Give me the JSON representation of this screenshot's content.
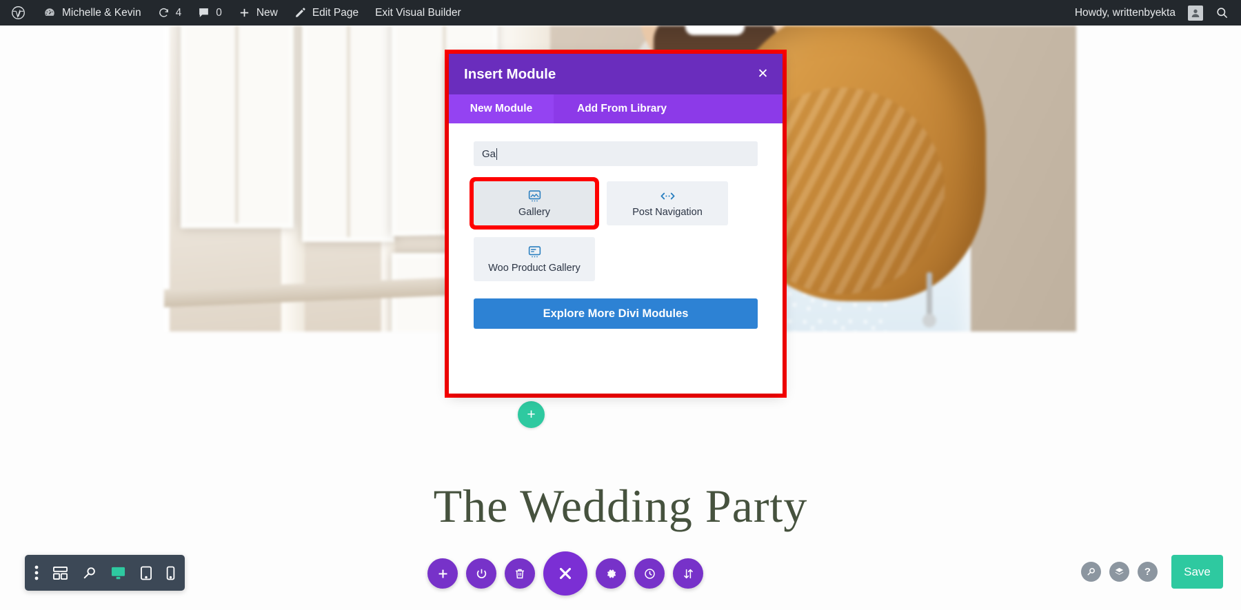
{
  "admin_bar": {
    "wp_logo_icon": "wordpress-logo-icon",
    "site": {
      "icon": "dashboard-icon",
      "label": "Michelle & Kevin"
    },
    "updates": {
      "icon": "updates-icon",
      "count": "4"
    },
    "comments": {
      "icon": "comment-bubble-icon",
      "count": "0"
    },
    "new": {
      "icon": "plus-icon",
      "label": "New"
    },
    "edit_page": {
      "icon": "pencil-icon",
      "label": "Edit Page"
    },
    "exit_builder": {
      "label": "Exit Visual Builder"
    },
    "howdy": "Howdy, writtenbyekta",
    "avatar_icon": "user-avatar-icon",
    "search_icon": "search-icon"
  },
  "modal": {
    "title": "Insert Module",
    "close_icon": "close-icon",
    "tabs": [
      {
        "label": "New Module",
        "active": true
      },
      {
        "label": "Add From Library",
        "active": false
      }
    ],
    "search": {
      "value": "Ga",
      "placeholder": ""
    },
    "modules": [
      {
        "label": "Gallery",
        "icon": "image-gallery-icon",
        "highlighted": true
      },
      {
        "label": "Post Navigation",
        "icon": "prev-next-arrows-icon",
        "highlighted": false
      },
      {
        "label": "Woo Product Gallery",
        "icon": "product-gallery-icon",
        "highlighted": false
      }
    ],
    "explore_button": "Explore More Divi Modules",
    "highlight_color": "#fe0000",
    "header_color": "#6a2dbd",
    "tab_active_color": "#9443f2",
    "explore_color": "#2d82d4"
  },
  "page": {
    "heading": "The Wedding Party",
    "module_add_icon": "cursor-icon",
    "row_add_icon": "plus-icon"
  },
  "bottom_left_toolbar": {
    "items": [
      {
        "icon": "vertical-dots-icon",
        "name": "toolbar-more",
        "active": false
      },
      {
        "icon": "wireframe-icon",
        "name": "wireframe-view",
        "active": false
      },
      {
        "icon": "zoom-out-icon",
        "name": "zoom-view",
        "active": false
      },
      {
        "icon": "desktop-icon",
        "name": "desktop-view",
        "active": true
      },
      {
        "icon": "tablet-icon",
        "name": "tablet-view",
        "active": false
      },
      {
        "icon": "phone-icon",
        "name": "phone-view",
        "active": false
      }
    ]
  },
  "bottom_center_toolbar": {
    "items": [
      {
        "icon": "plus-icon",
        "name": "add-section"
      },
      {
        "icon": "power-icon",
        "name": "toggle-builder"
      },
      {
        "icon": "trash-icon",
        "name": "clear-layout"
      },
      {
        "icon": "close-x-icon",
        "name": "close-menu",
        "big": true
      },
      {
        "icon": "gear-icon",
        "name": "page-settings"
      },
      {
        "icon": "history-clock-icon",
        "name": "editing-history"
      },
      {
        "icon": "portability-arrows-icon",
        "name": "portability"
      }
    ],
    "accent_color": "#7732c9"
  },
  "bottom_right": {
    "items": [
      {
        "icon": "zoom-icon",
        "name": "zoom-control"
      },
      {
        "icon": "layers-icon",
        "name": "layers-view"
      },
      {
        "icon": "help-question-icon",
        "name": "help"
      }
    ],
    "save_label": "Save",
    "save_color": "#2ec9a0"
  }
}
